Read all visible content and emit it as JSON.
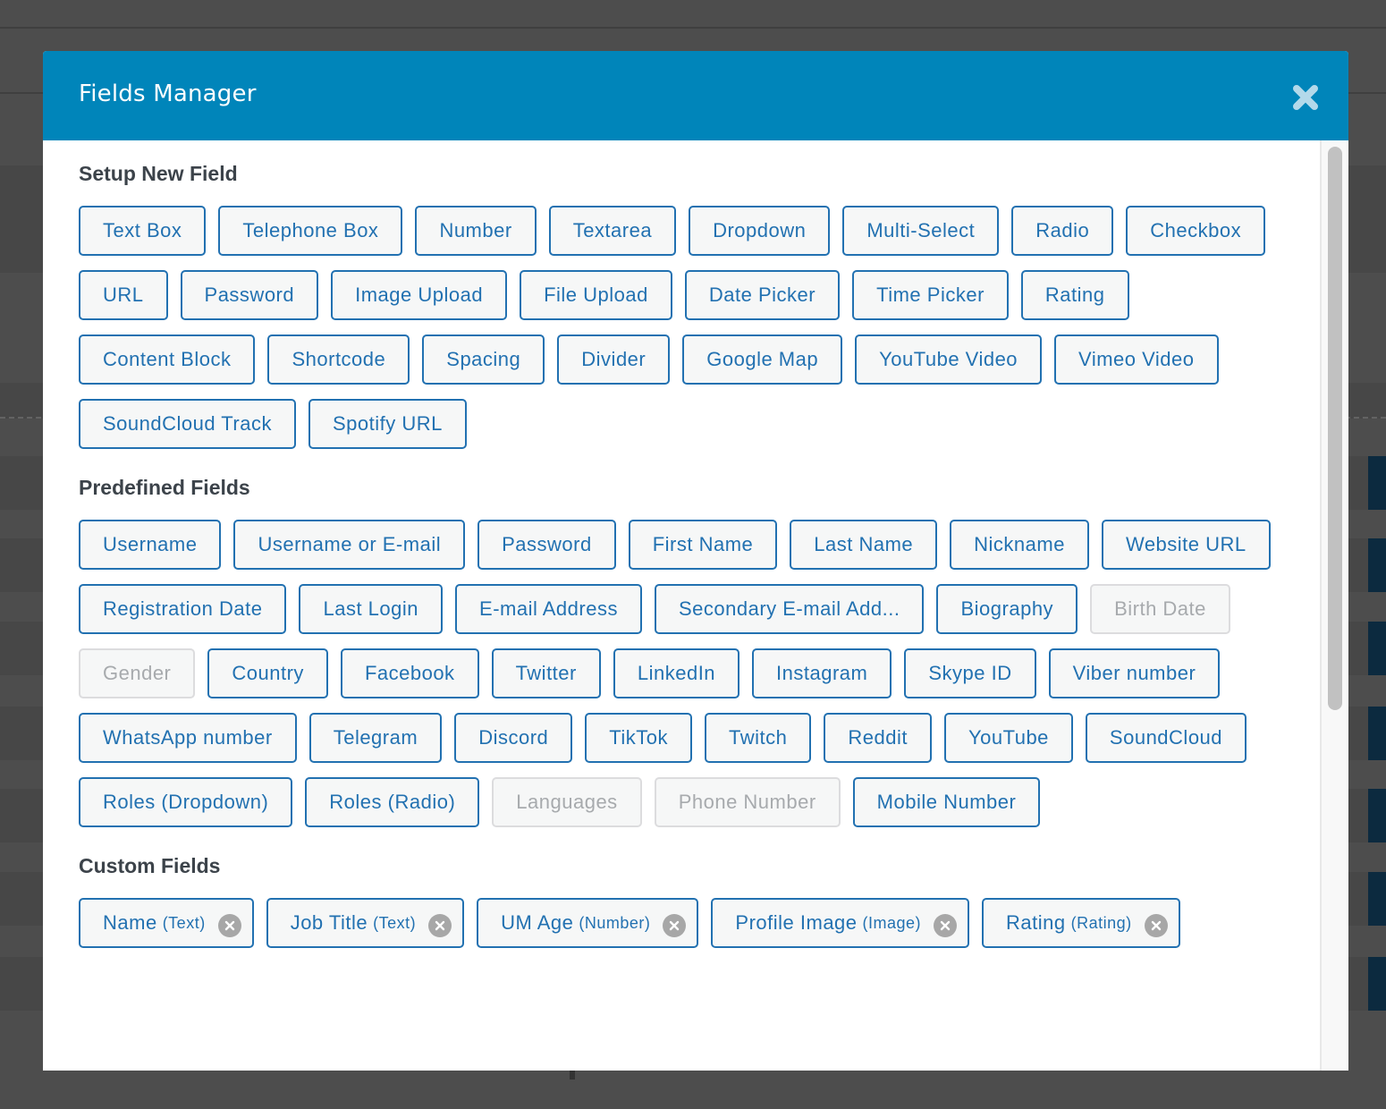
{
  "modal": {
    "title": "Fields Manager",
    "close_icon": "close-x-icon"
  },
  "colors": {
    "header_bg": "#0085ba",
    "button_border": "#2271b1",
    "button_text": "#2271b1",
    "button_bg": "#f6f7f7",
    "disabled_border": "#dcdcde",
    "disabled_text": "#a7aaad",
    "remove_icon_bg": "#a7a7a7"
  },
  "sections": {
    "setup": {
      "title": "Setup New Field",
      "buttons": [
        {
          "label": "Text Box"
        },
        {
          "label": "Telephone Box"
        },
        {
          "label": "Number"
        },
        {
          "label": "Textarea"
        },
        {
          "label": "Dropdown"
        },
        {
          "label": "Multi-Select"
        },
        {
          "label": "Radio"
        },
        {
          "label": "Checkbox"
        },
        {
          "label": "URL"
        },
        {
          "label": "Password"
        },
        {
          "label": "Image Upload"
        },
        {
          "label": "File Upload"
        },
        {
          "label": "Date Picker"
        },
        {
          "label": "Time Picker"
        },
        {
          "label": "Rating"
        },
        {
          "label": "Content Block"
        },
        {
          "label": "Shortcode"
        },
        {
          "label": "Spacing"
        },
        {
          "label": "Divider"
        },
        {
          "label": "Google Map"
        },
        {
          "label": "YouTube Video"
        },
        {
          "label": "Vimeo Video"
        },
        {
          "label": "SoundCloud Track"
        },
        {
          "label": "Spotify URL"
        }
      ]
    },
    "predefined": {
      "title": "Predefined Fields",
      "buttons": [
        {
          "label": "Username",
          "disabled": false
        },
        {
          "label": "Username or E-mail",
          "disabled": false
        },
        {
          "label": "Password",
          "disabled": false
        },
        {
          "label": "First Name",
          "disabled": false
        },
        {
          "label": "Last Name",
          "disabled": false
        },
        {
          "label": "Nickname",
          "disabled": false
        },
        {
          "label": "Website URL",
          "disabled": false
        },
        {
          "label": "Registration Date",
          "disabled": false
        },
        {
          "label": "Last Login",
          "disabled": false
        },
        {
          "label": "E-mail Address",
          "disabled": false
        },
        {
          "label": "Secondary E-mail Add...",
          "disabled": false
        },
        {
          "label": "Biography",
          "disabled": false
        },
        {
          "label": "Birth Date",
          "disabled": true
        },
        {
          "label": "Gender",
          "disabled": true
        },
        {
          "label": "Country",
          "disabled": false
        },
        {
          "label": "Facebook",
          "disabled": false
        },
        {
          "label": "Twitter",
          "disabled": false
        },
        {
          "label": "LinkedIn",
          "disabled": false
        },
        {
          "label": "Instagram",
          "disabled": false
        },
        {
          "label": "Skype ID",
          "disabled": false
        },
        {
          "label": "Viber number",
          "disabled": false
        },
        {
          "label": "WhatsApp number",
          "disabled": false
        },
        {
          "label": "Telegram",
          "disabled": false
        },
        {
          "label": "Discord",
          "disabled": false
        },
        {
          "label": "TikTok",
          "disabled": false
        },
        {
          "label": "Twitch",
          "disabled": false
        },
        {
          "label": "Reddit",
          "disabled": false
        },
        {
          "label": "YouTube",
          "disabled": false
        },
        {
          "label": "SoundCloud",
          "disabled": false
        },
        {
          "label": "Roles (Dropdown)",
          "disabled": false
        },
        {
          "label": "Roles (Radio)",
          "disabled": false
        },
        {
          "label": "Languages",
          "disabled": true
        },
        {
          "label": "Phone Number",
          "disabled": true
        },
        {
          "label": "Mobile Number",
          "disabled": false
        }
      ]
    },
    "custom": {
      "title": "Custom Fields",
      "buttons": [
        {
          "label": "Name",
          "type": "(Text)",
          "remove_icon": "remove-circle-x-icon"
        },
        {
          "label": "Job Title",
          "type": "(Text)",
          "remove_icon": "remove-circle-x-icon"
        },
        {
          "label": "UM Age",
          "type": "(Number)",
          "remove_icon": "remove-circle-x-icon"
        },
        {
          "label": "Profile Image",
          "type": "(Image)",
          "remove_icon": "remove-circle-x-icon"
        },
        {
          "label": "Rating",
          "type": "(Rating)",
          "remove_icon": "remove-circle-x-icon"
        }
      ]
    }
  }
}
